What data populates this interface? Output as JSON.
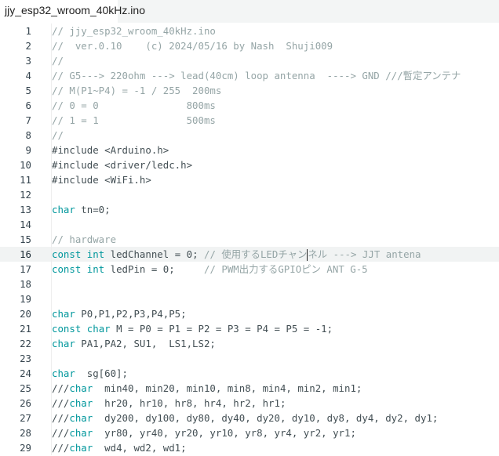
{
  "tab": {
    "title": "jjy_esp32_wroom_40kHz.ino"
  },
  "editor": {
    "current_line": 16,
    "lines": [
      [
        [
          "cm",
          "// jjy_esp32_wroom_40kHz.ino"
        ]
      ],
      [
        [
          "cm",
          "//  ver.0.10    (c) 2024/05/16 by Nash  Shuji009"
        ]
      ],
      [
        [
          "cm",
          "//"
        ]
      ],
      [
        [
          "cm",
          "// G5---> 220ohm ---> lead(40cm) loop antenna  ----> GND ///暫定アンテナ"
        ]
      ],
      [
        [
          "cm",
          "// M(P1~P4) = -1 / 255  200ms"
        ]
      ],
      [
        [
          "cm",
          "// 0 = 0               800ms"
        ]
      ],
      [
        [
          "cm",
          "// 1 = 1               500ms"
        ]
      ],
      [
        [
          "cm",
          "//"
        ]
      ],
      [
        [
          "tx",
          "#include <Arduino.h>"
        ]
      ],
      [
        [
          "tx",
          "#include <driver/ledc.h>"
        ]
      ],
      [
        [
          "tx",
          "#include <WiFi.h>"
        ]
      ],
      [],
      [
        [
          "kw",
          "char"
        ],
        [
          "tx",
          " tn=0;"
        ]
      ],
      [],
      [
        [
          "cm",
          "// hardware"
        ]
      ],
      [
        [
          "kw",
          "const"
        ],
        [
          "tx",
          " "
        ],
        [
          "kw",
          "int"
        ],
        [
          "tx",
          " ledChannel = 0; "
        ],
        [
          "cm",
          "// 使用するLEDチャン"
        ],
        [
          "caret",
          ""
        ],
        [
          "cm",
          "ネル ---> JJT antena"
        ]
      ],
      [
        [
          "kw",
          "const"
        ],
        [
          "tx",
          " "
        ],
        [
          "kw",
          "int"
        ],
        [
          "tx",
          " ledPin = 0;     "
        ],
        [
          "cm",
          "// PWM出力するGPIOピン ANT G-5"
        ]
      ],
      [],
      [],
      [
        [
          "kw",
          "char"
        ],
        [
          "tx",
          " P0,P1,P2,P3,P4,P5;"
        ]
      ],
      [
        [
          "kw",
          "const"
        ],
        [
          "tx",
          " "
        ],
        [
          "kw",
          "char"
        ],
        [
          "tx",
          " M = P0 = P1 = P2 = P3 = P4 = P5 = -1;"
        ]
      ],
      [
        [
          "kw",
          "char"
        ],
        [
          "tx",
          " PA1,PA2, SU1,  LS1,LS2;"
        ]
      ],
      [],
      [
        [
          "kw",
          "char"
        ],
        [
          "tx",
          "  sg[60];"
        ]
      ],
      [
        [
          "tx",
          "///"
        ],
        [
          "kw",
          "char"
        ],
        [
          "tx",
          "  min40, min20, min10, min8, min4, min2, min1;"
        ]
      ],
      [
        [
          "tx",
          "///"
        ],
        [
          "kw",
          "char"
        ],
        [
          "tx",
          "  hr20, hr10, hr8, hr4, hr2, hr1;"
        ]
      ],
      [
        [
          "tx",
          "///"
        ],
        [
          "kw",
          "char"
        ],
        [
          "tx",
          "  dy200, dy100, dy80, dy40, dy20, dy10, dy8, dy4, dy2, dy1;"
        ]
      ],
      [
        [
          "tx",
          "///"
        ],
        [
          "kw",
          "char"
        ],
        [
          "tx",
          "  yr80, yr40, yr20, yr10, yr8, yr4, yr2, yr1;"
        ]
      ],
      [
        [
          "tx",
          "///"
        ],
        [
          "kw",
          "char"
        ],
        [
          "tx",
          "  wd4, wd2, wd1;"
        ]
      ]
    ]
  }
}
